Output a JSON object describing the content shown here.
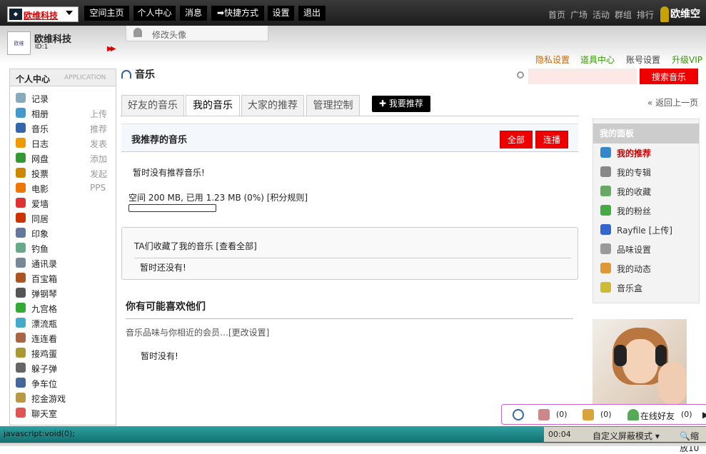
{
  "topbar": {
    "site_logo_text": "欧维科技",
    "nav": [
      "空间主页",
      "个人中心",
      "消息",
      "快捷方式",
      "设置",
      "退出"
    ],
    "right_nav": [
      "首页",
      "广场",
      "活动",
      "群组",
      "排行"
    ],
    "brand": "欧维空"
  },
  "profile": {
    "name": "欧维科技",
    "id": "ID:1",
    "change_avatar": "修改头像"
  },
  "top_links": {
    "privacy": "隐私设置",
    "tools": "道具中心",
    "account": "账号设置",
    "vip": "升级VIP"
  },
  "sidebar": {
    "title": "个人中心",
    "subtitle": "APPLICATION",
    "items": [
      {
        "label": "记录",
        "action": "",
        "icon": "record-icon",
        "color": "#8ab"
      },
      {
        "label": "相册",
        "action": "上传",
        "icon": "album-icon",
        "color": "#49c"
      },
      {
        "label": "音乐",
        "action": "推荐",
        "icon": "music-icon",
        "color": "#36a"
      },
      {
        "label": "日志",
        "action": "发表",
        "icon": "blog-icon",
        "color": "#e90"
      },
      {
        "label": "网盘",
        "action": "添加",
        "icon": "netdisk-icon",
        "color": "#393"
      },
      {
        "label": "投票",
        "action": "发起",
        "icon": "vote-icon",
        "color": "#c80"
      },
      {
        "label": "电影",
        "action": "PPS",
        "icon": "movie-icon",
        "color": "#e70"
      },
      {
        "label": "爱墙",
        "action": "",
        "icon": "love-wall-icon",
        "color": "#d33"
      },
      {
        "label": "同居",
        "action": "",
        "icon": "cohabit-icon",
        "color": "#c30"
      },
      {
        "label": "印象",
        "action": "",
        "icon": "impression-icon",
        "color": "#679"
      },
      {
        "label": "钓鱼",
        "action": "",
        "icon": "fishing-icon",
        "color": "#6a8"
      },
      {
        "label": "通讯录",
        "action": "",
        "icon": "contacts-icon",
        "color": "#789"
      },
      {
        "label": "百宝箱",
        "action": "",
        "icon": "treasure-icon",
        "color": "#a52"
      },
      {
        "label": "弹钢琴",
        "action": "",
        "icon": "piano-icon",
        "color": "#555"
      },
      {
        "label": "九宫格",
        "action": "",
        "icon": "sudoku-icon",
        "color": "#3a3"
      },
      {
        "label": "漂流瓶",
        "action": "",
        "icon": "bottle-icon",
        "color": "#4ac"
      },
      {
        "label": "连连看",
        "action": "",
        "icon": "link-game-icon",
        "color": "#a64"
      },
      {
        "label": "接鸡蛋",
        "action": "",
        "icon": "egg-game-icon",
        "color": "#a93"
      },
      {
        "label": "躲子弹",
        "action": "",
        "icon": "bullet-game-icon",
        "color": "#666"
      },
      {
        "label": "争车位",
        "action": "",
        "icon": "parking-icon",
        "color": "#469"
      },
      {
        "label": "挖金游戏",
        "action": "",
        "icon": "gold-game-icon",
        "color": "#b94"
      },
      {
        "label": "聊天室",
        "action": "",
        "icon": "chat-icon",
        "color": "#d55"
      }
    ]
  },
  "main": {
    "title": "音乐",
    "search_placeholder": "",
    "search_button": "搜索音乐",
    "tabs": [
      "好友的音乐",
      "我的音乐",
      "大家的推荐",
      "管理控制"
    ],
    "active_tab": 1,
    "recommend_button": "我要推荐",
    "back_link": "« 返回上一页",
    "recommended_title": "我推荐的音乐",
    "btn_all": "全部",
    "btn_play": "连播",
    "no_recommend": "暂时没有推荐音乐!",
    "space_text": "空间  200 MB, 已用  1.23 MB (0%) [积分规则]",
    "space_used_percent": 0,
    "fav_title": "TA们收藏了我的音乐  [查看全部]",
    "fav_empty": "暂时还没有!",
    "like_heading": "你有可能喜欢他们",
    "like_sub": "音乐品味与你相近的会员…[更改设置]",
    "like_empty": "暂时没有!"
  },
  "panel": {
    "title": "我的面板",
    "items": [
      {
        "label": "我的推荐",
        "icon": "note-icon",
        "color": "#38c",
        "selected": true
      },
      {
        "label": "我的专辑",
        "icon": "cd-icon",
        "color": "#888",
        "selected": false
      },
      {
        "label": "我的收藏",
        "icon": "favorite-icon",
        "color": "#6a6",
        "selected": false
      },
      {
        "label": "我的粉丝",
        "icon": "puzzle-icon",
        "color": "#4a4",
        "selected": false
      },
      {
        "label": "Rayfile [上传]",
        "icon": "disk-icon",
        "color": "#36c",
        "selected": false
      },
      {
        "label": "品味设置",
        "icon": "wrench-icon",
        "color": "#999",
        "selected": false
      },
      {
        "label": "我的动态",
        "icon": "clock-icon",
        "color": "#d93",
        "selected": false
      },
      {
        "label": "音乐盒",
        "icon": "musicbox-icon",
        "color": "#cb3",
        "selected": false
      }
    ]
  },
  "tray": {
    "mail_count": "(0)",
    "group_count": "(0)",
    "online_label": "在线好友",
    "online_count": "(0)"
  },
  "statusbar": {
    "text": "javascript:void(0);",
    "time": "00:04",
    "mode": "自定义屏蔽模式",
    "zoom": "缩放10"
  }
}
